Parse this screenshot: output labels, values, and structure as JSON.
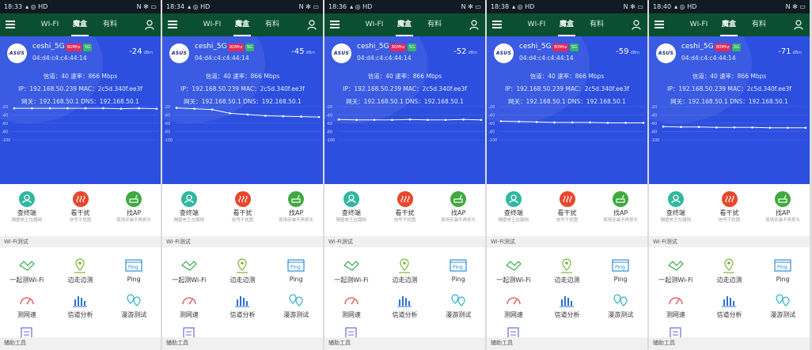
{
  "colors": {
    "accent": "#2c4fe0",
    "header": "#0b4f32",
    "find_terminal": "#2fb89f",
    "interference": "#e8472c",
    "find_ap": "#3faa3f"
  },
  "icons": [
    "menu-icon",
    "user-icon",
    "asus-logo",
    "find-terminal-icon",
    "interference-icon",
    "router-icon",
    "handshake-icon",
    "location-pin-icon",
    "ping-icon",
    "speedometer-icon",
    "bar-chart-icon",
    "roaming-pin-icon",
    "checklist-icon"
  ],
  "tabs": [
    "WI-FI",
    "魔盒",
    "有料"
  ],
  "active_tab_index": 1,
  "ssid": "ceshi_5G",
  "bandwidth_badge": "80Mhz",
  "band_badge": "5G",
  "bssid": "04:d4:c4:c4:44:14",
  "rssi_unit": "dBm",
  "logo_text": "ASUS",
  "channel_line": "信道：40   速率：866 Mbps",
  "ip_line": "IP：192.168.50.239   MAC：2c5d.340f.ee3f",
  "gateway_line": "网关：192.168.50.1   DNS：192.168.50.1",
  "chart_ticks": [
    "-20",
    "-40",
    "-60",
    "-80",
    "-100"
  ],
  "tools": [
    {
      "name": "查终端",
      "sub": "隔壁老王在蹭网"
    },
    {
      "name": "看干扰",
      "sub": "信号干扰图"
    },
    {
      "name": "找AP",
      "sub": "现场安装不再抓头"
    }
  ],
  "wifi_test_section": "Wi-Fi测试",
  "wifi_tests": [
    "一起测Wi-Fi",
    "边走边测",
    "Ping",
    "测网速",
    "信道分析",
    "漫游测试",
    "单点测试"
  ],
  "aux_section": "辅助工具",
  "screens": [
    {
      "status_time": "18:33",
      "rssi": "-24",
      "signal": [
        -24,
        -24,
        -24,
        -24,
        -24,
        -24,
        -25,
        -24,
        -25
      ]
    },
    {
      "status_time": "18:34",
      "rssi": "-45",
      "signal": [
        -23,
        -25,
        -27,
        -36,
        -39,
        -42,
        -43,
        -44,
        -45
      ]
    },
    {
      "status_time": "18:36",
      "rssi": "-52",
      "signal": [
        -51,
        -52,
        -52,
        -52,
        -51,
        -52,
        -52,
        -51,
        -52
      ]
    },
    {
      "status_time": "18:38",
      "rssi": "-59",
      "signal": [
        -55,
        -56,
        -57,
        -58,
        -58,
        -58,
        -59,
        -59,
        -59
      ]
    },
    {
      "status_time": "18:40",
      "rssi": "-71",
      "signal": [
        -68,
        -69,
        -69,
        -70,
        -70,
        -70,
        -71,
        -71,
        -71
      ]
    }
  ],
  "status_right": "N ✻ ▭",
  "status_left_suffix": "▴ ◎ HD"
}
